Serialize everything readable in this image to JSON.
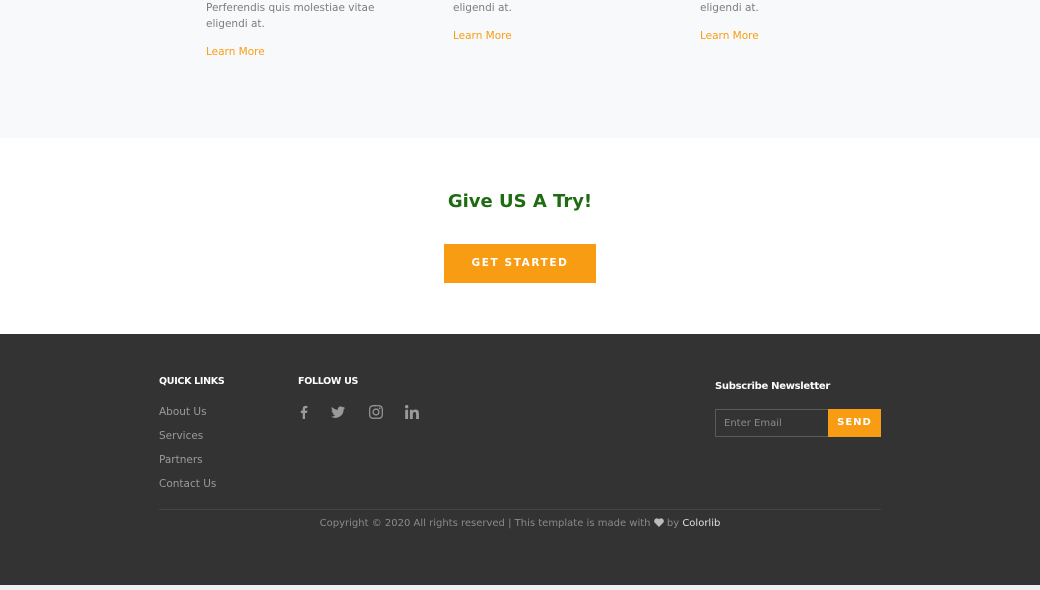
{
  "services": [
    {
      "text_lines": [
        "Perferendis quis molestiae vitae",
        "eligendi at."
      ],
      "link": "Learn More"
    },
    {
      "text_lines": [
        "eligendi at."
      ],
      "link": "Learn More"
    },
    {
      "text_lines": [
        "eligendi at."
      ],
      "link": "Learn More"
    }
  ],
  "cta": {
    "title": "Give US A Try!",
    "button": "GET STARTED"
  },
  "footer": {
    "quick_links_title": "QUICK LINKS",
    "quick_links": [
      "About Us",
      "Services",
      "Partners",
      "Contact Us"
    ],
    "follow_title": "FOLLOW US",
    "social_icons": [
      "facebook-icon",
      "twitter-icon",
      "instagram-icon",
      "linkedin-icon"
    ],
    "newsletter_title": "Subscribe Newsletter",
    "email_placeholder": "Enter Email",
    "send_label": "SEND",
    "copyright_prefix": "Copyright © 2020 All rights reserved | This template is made with",
    "copyright_by": "by",
    "brand": "Colorlib"
  },
  "colors": {
    "accent": "#f89d13",
    "cta_title": "#1e6b12",
    "footer_bg": "#333333"
  }
}
